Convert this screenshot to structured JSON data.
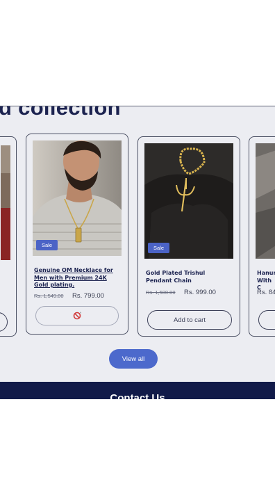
{
  "section": {
    "heading": "d collection"
  },
  "products": [
    {
      "title": "Genuine OM Necklace for Men with Premium 24K Gold plating.",
      "badge": "Sale",
      "old_price": "Rs. 1,549.00",
      "price": "Rs. 799.00",
      "button_state": "sold-out / disabled"
    },
    {
      "title": "Gold Plated Trishul Pendant Chain",
      "badge": "Sale",
      "old_price": "Rs. 1,500.00",
      "price": "Rs. 999.00",
      "button_label": "Add to cart"
    },
    {
      "title_partial": "Hanun With C",
      "price_partial": "Rs. 84"
    }
  ],
  "view_all_label": "View all",
  "footer": {
    "title": "Contact Us"
  },
  "colors": {
    "heading": "#1c2350",
    "sale_badge": "#4b63c6",
    "view_all": "#4c69cc",
    "footer": "#111a49",
    "section_bg": "#ecedf2"
  }
}
